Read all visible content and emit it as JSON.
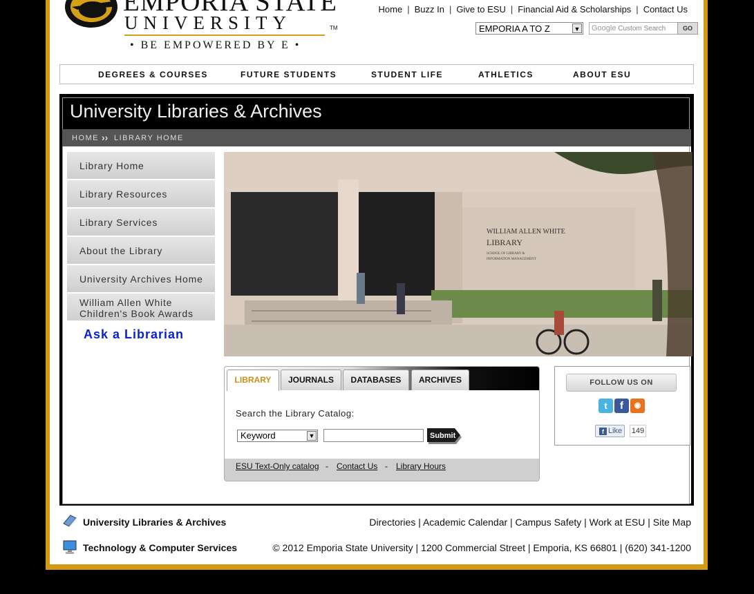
{
  "logo": {
    "line1": "EMPORIA STATE",
    "line2": "UNIVERSITY",
    "tm": "TM",
    "tagline": "• BE EMPOWERED BY E •"
  },
  "toplinks": [
    "Home",
    "Buzz In",
    "Give to ESU",
    "Financial Aid & Scholarships",
    "Contact Us"
  ],
  "atoz_select": "EMPORIA A TO Z",
  "google_search": {
    "brand": "Google",
    "placeholder": "Custom Search",
    "button": "GO"
  },
  "main_nav": [
    "DEGREES & COURSES",
    "FUTURE STUDENTS",
    "STUDENT LIFE",
    "ATHLETICS",
    "ABOUT ESU"
  ],
  "page_title": "University Libraries & Archives",
  "breadcrumb": {
    "home": "HOME",
    "sep": "››",
    "current": "LIBRARY HOME"
  },
  "sidebar": {
    "items": [
      "Library Home",
      "Library Resources",
      "Library Services",
      "About the Library",
      "University Archives Home"
    ],
    "two_line_item": {
      "line1": "William Allen White",
      "line2": "Children's Book Awards"
    },
    "ask": "Ask a Librarian"
  },
  "photo": {
    "sign_line1": "WILLIAM ALLEN WHITE",
    "sign_line2": "LIBRARY",
    "sign_line3": "SCHOOL OF LIBRARY &",
    "sign_line4": "INFORMATION MANAGEMENT"
  },
  "search_widget": {
    "tabs": [
      "LIBRARY",
      "JOURNALS",
      "DATABASES",
      "ARCHIVES"
    ],
    "label": "Search the Library Catalog:",
    "select_value": "Keyword",
    "submit": "Submit",
    "footer_links": [
      "ESU Text-Only catalog",
      "Contact Us",
      "Library Hours"
    ],
    "footer_sep": "-"
  },
  "follow": {
    "title": "FOLLOW US ON",
    "icons": [
      "twitter-icon",
      "facebook-icon",
      "rss-icon"
    ],
    "like": "Like",
    "like_count": "149"
  },
  "footer": {
    "lib_label": "University Libraries & Archives",
    "tech_label": "Technology & Computer Services",
    "links": "Directories | Academic Calendar | Campus Safety | Work at ESU | Site Map",
    "address": "© 2012 Emporia State University | 1200 Commercial Street | Emporia, KS 66801 | (620) 341-1200"
  },
  "colors": {
    "gold": "#d49a14",
    "link_blue": "#0a22cc",
    "active_tab": "#c8901a"
  }
}
